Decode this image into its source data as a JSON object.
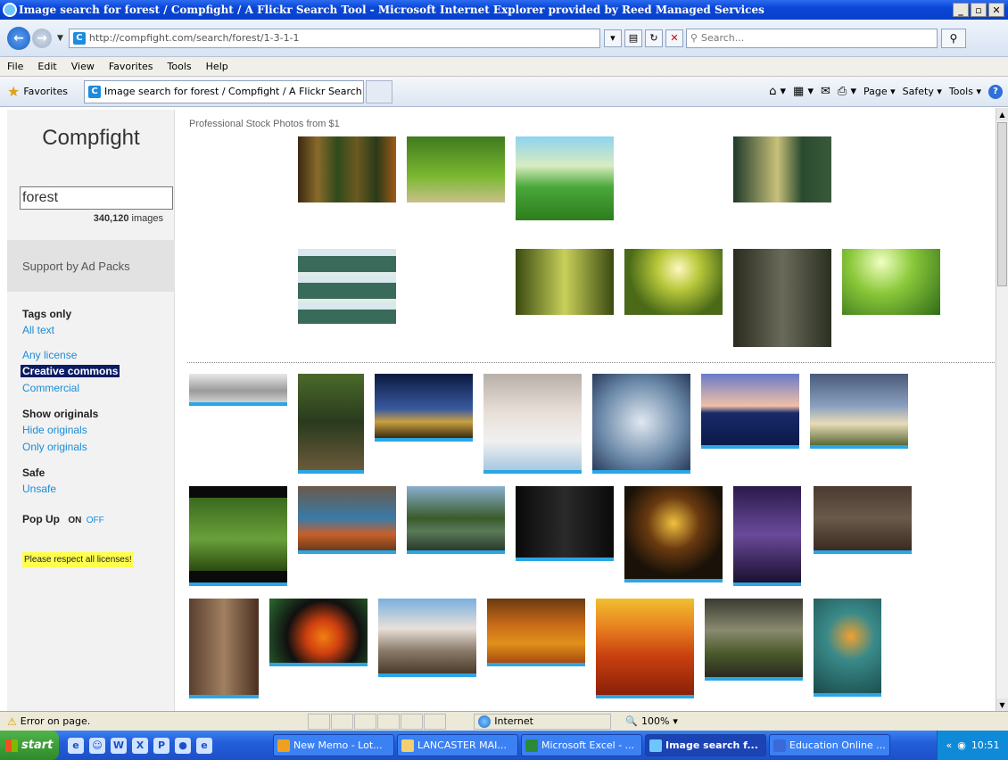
{
  "window": {
    "title": "Image search for forest / Compfight / A Flickr Search Tool - Microsoft Internet Explorer provided by Reed Managed Services",
    "buttons": [
      "_",
      "̅",
      "X"
    ]
  },
  "addressbar": {
    "url": "http://compfight.com/search/forest/1-3-1-1",
    "search_placeholder": "Search..."
  },
  "menubar": [
    "File",
    "Edit",
    "View",
    "Favorites",
    "Tools",
    "Help"
  ],
  "favoritesbar": {
    "favorites_label": "Favorites",
    "tab_title": "Image search for forest / Compfight / A Flickr Search ...",
    "commands": [
      "Page",
      "Safety",
      "Tools"
    ]
  },
  "sidebar": {
    "brand": "Compfight",
    "search_value": "forest",
    "count_number": "340,120",
    "count_suffix": "images",
    "ad_text": "Support by Ad Packs",
    "tags_only": "Tags only",
    "all_text": "All text",
    "any_license": "Any license",
    "creative_commons": "Creative commons",
    "commercial": "Commercial",
    "show_originals": "Show originals",
    "hide_originals": "Hide originals",
    "only_originals": "Only originals",
    "safe": "Safe",
    "unsafe": "Unsafe",
    "popup_label": "Pop Up",
    "popup_on": "ON",
    "popup_off": "OFF",
    "respect": "Please respect all licenses!"
  },
  "content": {
    "promo": "Professional Stock Photos from $1"
  },
  "statusbar": {
    "message": "Error on page.",
    "zone": "Internet",
    "zoom": "100%"
  },
  "taskbar": {
    "start": "start",
    "tasks": [
      "New Memo - Lot...",
      "LANCASTER MAI...",
      "Microsoft Excel - ...",
      "Image search f...",
      "Education Online ..."
    ],
    "clock": "10:51"
  },
  "colors": {
    "accent": "#1a8cd8",
    "thumb_bar": "#2aa6e4",
    "highlight": "#0b1b64",
    "notice": "#ffff4d"
  }
}
